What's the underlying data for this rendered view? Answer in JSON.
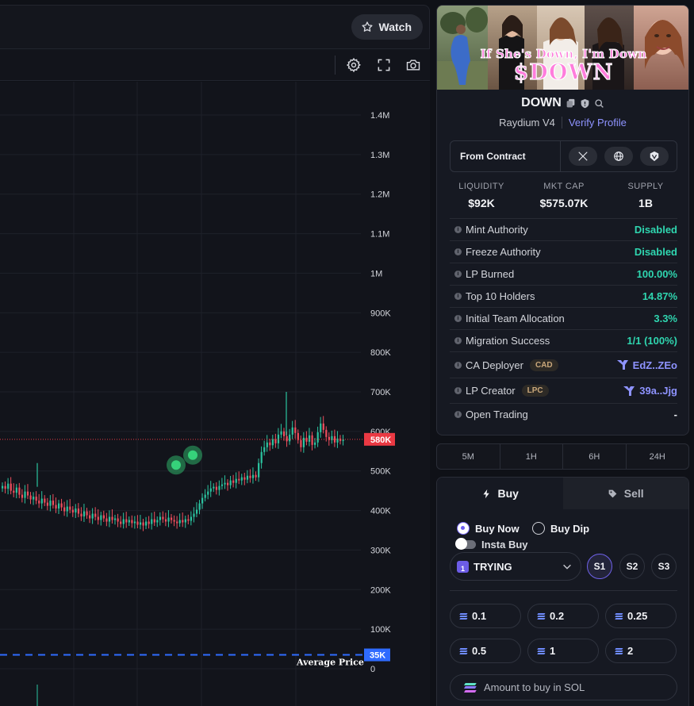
{
  "header": {
    "watch_label": "Watch",
    "watch_icon": "star-icon"
  },
  "toolbar": {
    "icons": [
      "settings-icon",
      "fullscreen-icon",
      "camera-icon"
    ]
  },
  "chart_data": {
    "type": "candlestick",
    "y_ticks": [
      "1.4M",
      "1.3M",
      "1.2M",
      "1.1M",
      "1M",
      "900K",
      "800K",
      "700K",
      "600K",
      "500K",
      "400K",
      "300K",
      "200K",
      "100K",
      "0"
    ],
    "ylim": [
      0,
      1400000
    ],
    "current_price_label": "580K",
    "current_price": 580000,
    "average_price_label": "35K",
    "average_price": 35000,
    "average_price_text": "Average Price",
    "colors": {
      "up": "#2bc4a0",
      "down": "#ef4f5e",
      "current": "#ea3943",
      "average": "#2f6bff"
    },
    "trade_markers": [
      {
        "value": 515000,
        "color": "#36d27a"
      },
      {
        "value": 540000,
        "color": "#36d27a"
      }
    ],
    "series": [
      {
        "name": "close",
        "values": [
          462,
          455,
          468,
          450,
          445,
          458,
          440,
          432,
          448,
          438,
          428,
          435,
          425,
          418,
          430,
          420,
          412,
          425,
          414,
          405,
          418,
          408,
          398,
          410,
          402,
          395,
          405,
          392,
          385,
          398,
          388,
          380,
          392,
          384,
          376,
          388,
          380,
          372,
          384,
          376,
          380,
          372,
          366,
          378,
          370,
          376,
          368,
          372,
          364,
          370,
          362,
          372,
          366,
          378,
          370,
          376,
          384,
          378,
          372,
          382,
          376,
          372,
          368,
          376,
          370,
          378,
          374,
          384,
          392,
          402,
          418,
          432,
          440,
          448,
          456,
          460,
          452,
          462,
          466,
          470,
          464,
          476,
          470,
          480,
          476,
          484,
          478,
          488,
          482,
          490,
          484,
          520,
          548,
          560,
          572,
          565,
          580,
          570,
          592,
          600,
          588,
          575,
          592,
          610,
          596,
          578,
          560,
          584,
          574,
          590,
          566,
          572,
          598,
          620,
          604,
          586,
          578,
          588,
          572,
          582,
          576,
          580
        ]
      }
    ]
  },
  "token": {
    "banner_caption_line1": "If She's Down, I'm Down",
    "banner_caption_line2": "$DOWN",
    "name": "DOWN",
    "dex": "Raydium V4",
    "verify_label": "Verify Profile",
    "contract_label": "From Contract",
    "social_icons": [
      "x-icon",
      "globe-icon",
      "telegram-icon"
    ]
  },
  "stats": [
    {
      "label": "LIQUIDITY",
      "value": "$92K"
    },
    {
      "label": "MKT CAP",
      "value": "$575.07K"
    },
    {
      "label": "SUPPLY",
      "value": "1B"
    }
  ],
  "audit": [
    {
      "label": "Mint Authority",
      "value": "Disabled"
    },
    {
      "label": "Freeze Authority",
      "value": "Disabled"
    },
    {
      "label": "LP Burned",
      "value": "100.00%"
    },
    {
      "label": "Top 10 Holders",
      "value": "14.87%"
    },
    {
      "label": "Initial Team Allocation",
      "value": "3.3%"
    },
    {
      "label": "Migration Success",
      "value": "1/1 (100%)"
    },
    {
      "label": "CA Deployer",
      "tag": "CAD",
      "value": "EdZ..ZEo"
    },
    {
      "label": "LP Creator",
      "tag": "LPC",
      "value": "39a..Jjg"
    },
    {
      "label": "Open Trading",
      "value": "-"
    }
  ],
  "timeframes": [
    "5M",
    "1H",
    "6H",
    "24H"
  ],
  "trade": {
    "buy_label": "Buy",
    "sell_label": "Sell",
    "buy_now_label": "Buy Now",
    "buy_dip_label": "Buy Dip",
    "insta_buy_label": "Insta Buy",
    "preset_badge": "1",
    "preset_name": "TRYING",
    "slots": [
      "S1",
      "S2",
      "S3"
    ],
    "amounts": [
      "0.1",
      "0.2",
      "0.25",
      "0.5",
      "1",
      "2"
    ],
    "amount_placeholder": "Amount to buy in SOL"
  }
}
